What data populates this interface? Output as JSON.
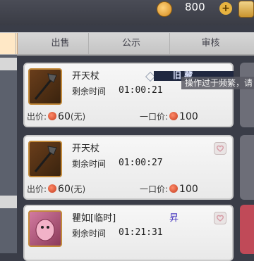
{
  "header": {
    "gold": "800",
    "plus": "+"
  },
  "tabs": [
    {
      "label": "出售"
    },
    {
      "label": "公示"
    },
    {
      "label": "审核"
    }
  ],
  "notice": "操作过于频繁，请",
  "listings": [
    {
      "name": "开天杖",
      "time_label": "剩余时间",
      "time": "01:00:21",
      "price_label": "出价:",
      "bid": "60",
      "bid_note": "(无)",
      "buyout_label": "一口价:",
      "buyout": "100",
      "overlay_text": "旧 藏"
    },
    {
      "name": "开天杖",
      "time_label": "剩余时间",
      "time": "01:00:27",
      "price_label": "出价:",
      "bid": "60",
      "bid_note": "(无)",
      "buyout_label": "一口价:",
      "buyout": "100"
    },
    {
      "name": "瞿如[临时]",
      "time_label": "剩余时间",
      "time": "01:21:31",
      "tag": "昇"
    }
  ],
  "colors": {
    "background": "#3a3d48",
    "card": "#f2f2f2",
    "tab_bar": "#cfcfcf",
    "accent_coin": "#c23a1d"
  }
}
